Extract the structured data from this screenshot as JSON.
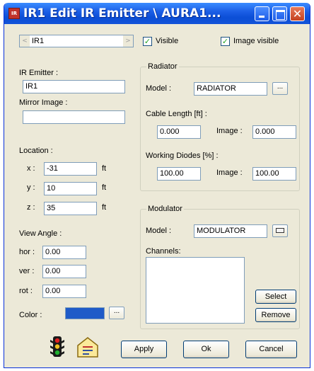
{
  "window": {
    "title": "IR1 Edit IR Emitter \\ AURA1...",
    "app_icon": "app-icon",
    "close_glyph": "✕"
  },
  "nav": {
    "current": "IR1",
    "prev_glyph": "<",
    "next_glyph": ">"
  },
  "checks": {
    "visible_label": "Visible",
    "visible_checked": true,
    "image_visible_label": "Image visible",
    "image_visible_checked": true,
    "check_glyph": "✓"
  },
  "left": {
    "ir_emitter_label": "IR Emitter :",
    "ir_emitter_value": "IR1",
    "mirror_label": "Mirror Image :",
    "mirror_value": "",
    "location_label": "Location :",
    "x_label": "x :",
    "x_value": "-31",
    "y_label": "y :",
    "y_value": "10",
    "z_label": "z :",
    "z_value": "35",
    "unit": "ft",
    "view_angle_label": "View Angle :",
    "hor_label": "hor :",
    "hor_value": "0.00",
    "ver_label": "ver :",
    "ver_value": "0.00",
    "rot_label": "rot :",
    "rot_value": "0.00",
    "color_label": "Color :",
    "color_value": "#1f5bc8",
    "color_button": "..."
  },
  "radiator": {
    "group_title": "Radiator",
    "model_label": "Model :",
    "model_value": "RADIATOR",
    "model_button": "...",
    "cable_label": "Cable Length [ft] :",
    "cable_value": "0.000",
    "cable_image_label": "Image :",
    "cable_image_value": "0.000",
    "diodes_label": "Working Diodes [%] :",
    "diodes_value": "100.00",
    "diodes_image_label": "Image :",
    "diodes_image_value": "100.00"
  },
  "modulator": {
    "group_title": "Modulator",
    "model_label": "Model :",
    "model_value": "MODULATOR",
    "channels_label": "Channels:",
    "select_button": "Select",
    "remove_button": "Remove"
  },
  "footer": {
    "traffic_light_icon": "traffic-light-icon",
    "notes_icon": "notes-house-icon",
    "apply_button": "Apply",
    "ok_button": "Ok",
    "cancel_button": "Cancel"
  }
}
